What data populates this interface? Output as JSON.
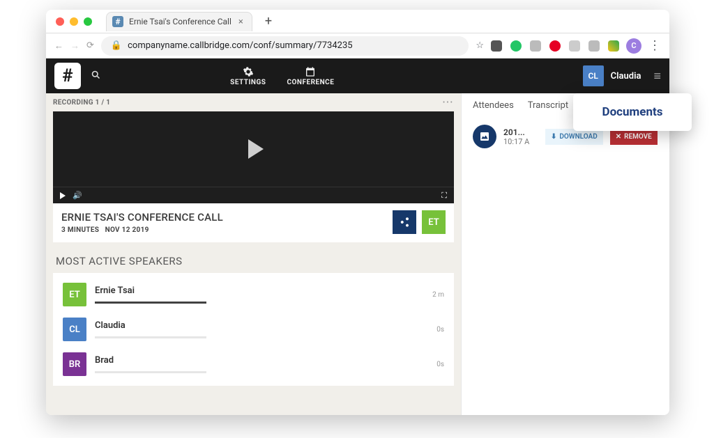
{
  "browser": {
    "tab_title": "Ernie Tsai's Conference Call",
    "url": "companyname.callbridge.com/conf/summary/7734235",
    "profile_initial": "C"
  },
  "appbar": {
    "nav": {
      "settings": "SETTINGS",
      "conference": "CONFERENCE"
    },
    "user": {
      "initials": "CL",
      "name": "Claudia"
    }
  },
  "recording": {
    "header": "RECORDING 1 / 1",
    "title": "ERNIE TSAI'S CONFERENCE CALL",
    "duration": "3 MINUTES",
    "date": "NOV 12 2019",
    "owner_initials": "ET"
  },
  "speakers_section": "MOST ACTIVE SPEAKERS",
  "speakers": [
    {
      "initials": "ET",
      "name": "Ernie Tsai",
      "duration": "2 m",
      "pct": 100
    },
    {
      "initials": "CL",
      "name": "Claudia",
      "duration": "0s",
      "pct": 0
    },
    {
      "initials": "BR",
      "name": "Brad",
      "duration": "0s",
      "pct": 0
    }
  ],
  "side_tabs": {
    "attendees": "Attendees",
    "transcript": "Transcript"
  },
  "popover": "Documents",
  "document": {
    "name": "201...",
    "time": "10:17 A",
    "download": "DOWNLOAD",
    "remove": "REMOVE"
  }
}
